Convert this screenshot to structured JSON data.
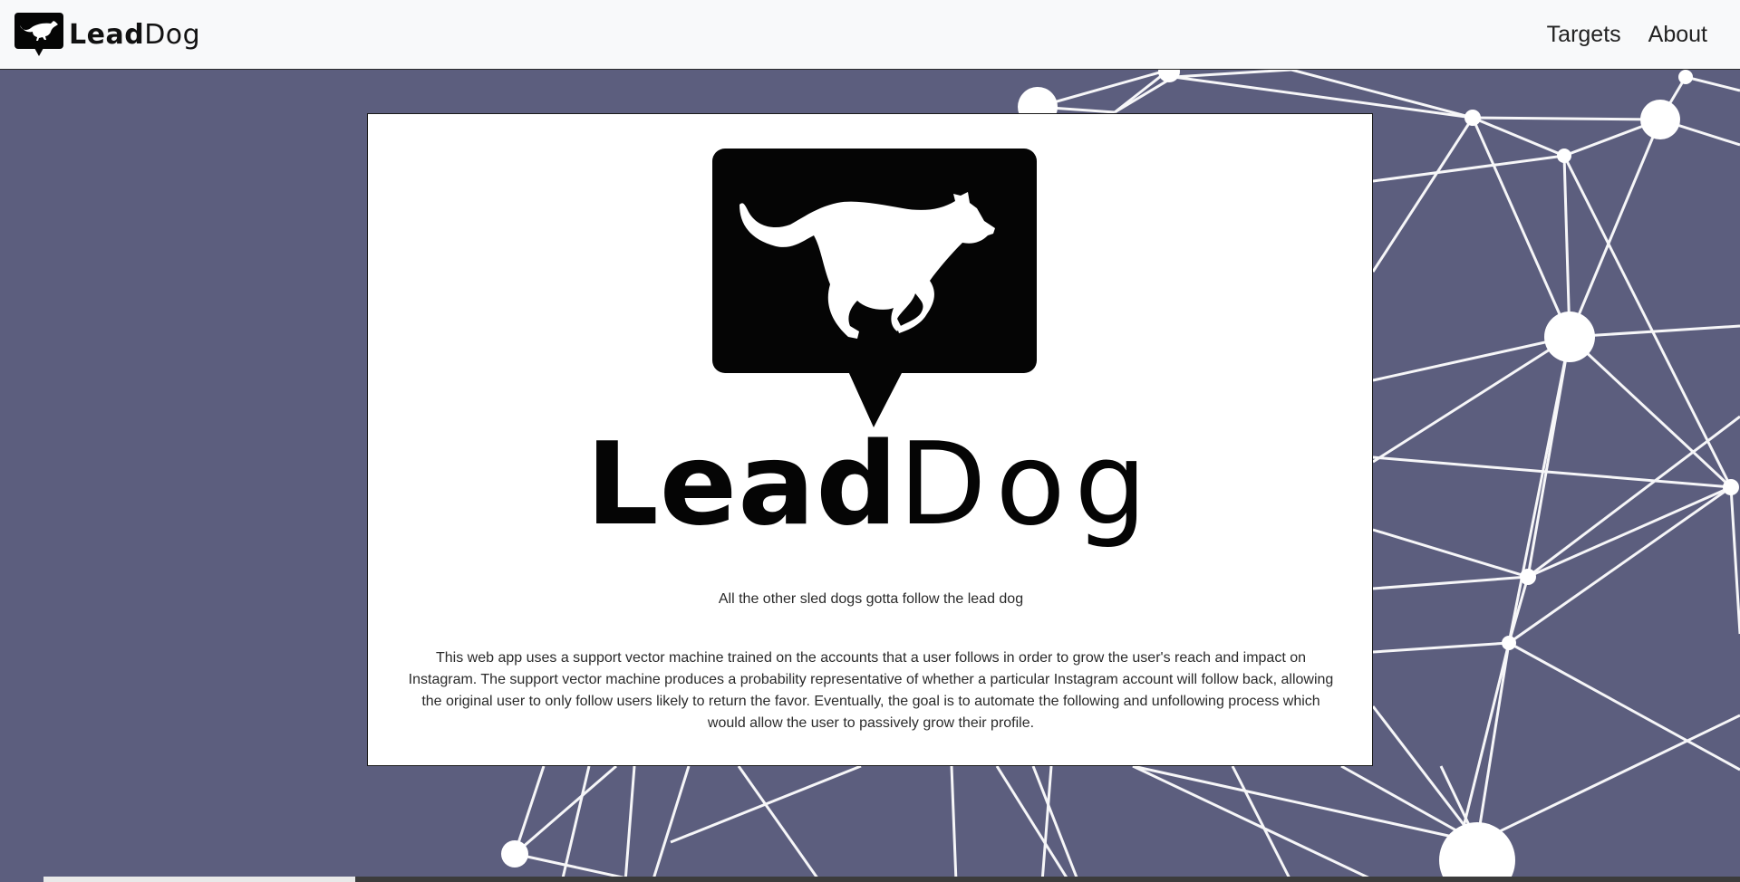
{
  "navbar": {
    "brand_bold": "Lead",
    "brand_regular": "Dog",
    "brand_logo_icon": "dog-speech-bubble-icon",
    "links": [
      {
        "label": "Targets"
      },
      {
        "label": "About"
      }
    ]
  },
  "hero": {
    "logo_icon": "running-dog-speech-bubble-icon",
    "title_bold": "Lead",
    "title_regular": "Dog",
    "tagline": "All the other sled dogs gotta follow the lead dog",
    "description": "This web app uses a support vector machine trained on the accounts that a user follows in order to grow the user's reach and impact on Instagram. The support vector machine produces a probability representative of whether a particular Instagram account will follow back, allowing the original user to only follow users likely to return the favor. Eventually, the goal is to automate the following and unfollowing process which would allow the user to passively grow their profile."
  },
  "theme": {
    "background": "#5c5e7e",
    "card": "#ffffff",
    "navbar": "#f8f9fa",
    "ink": "#050505"
  }
}
